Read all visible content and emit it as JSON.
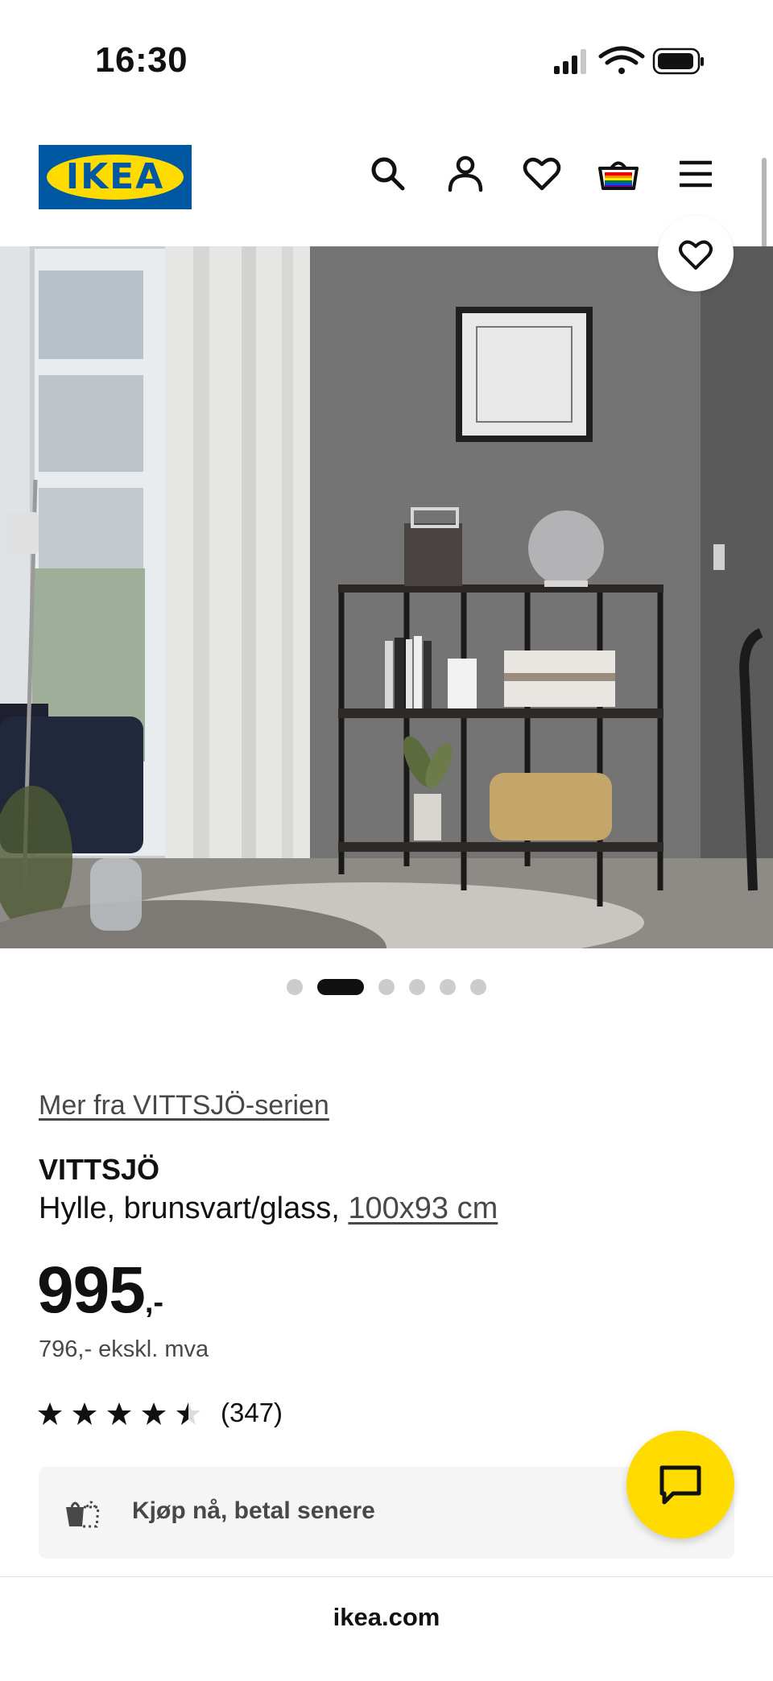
{
  "status_bar": {
    "time": "16:30",
    "icons": [
      "signal-icon",
      "wifi-icon",
      "battery-icon"
    ]
  },
  "header": {
    "logo_text": "IKEA",
    "icons": [
      "search-icon",
      "account-icon",
      "wishlist-heart-icon",
      "cart-icon",
      "menu-icon"
    ]
  },
  "gallery": {
    "dot_count": 6,
    "active_dot": 2,
    "favourite_icon": "heart-outline-icon"
  },
  "product": {
    "series_link": "Mer fra VITTSJÖ-serien",
    "name": "VITTSJÖ",
    "description": "Hylle, brunsvart/glass,",
    "size": "100x93 cm",
    "price": "995",
    "price_suffix": ",-",
    "price_ex_vat": "796,- ekskl. mva",
    "rating": 4.5,
    "rating_max": 5,
    "review_count": "(347)"
  },
  "pay_later": {
    "label": "Kjøp nå, betal senere",
    "icon": "pay-later-icon"
  },
  "chat": {
    "icon": "chat-icon"
  },
  "browser": {
    "domain": "ikea.com"
  },
  "colors": {
    "brand_blue": "#0058a3",
    "brand_yellow": "#ffdb00",
    "text": "#111111",
    "secondary_text": "#484848"
  }
}
